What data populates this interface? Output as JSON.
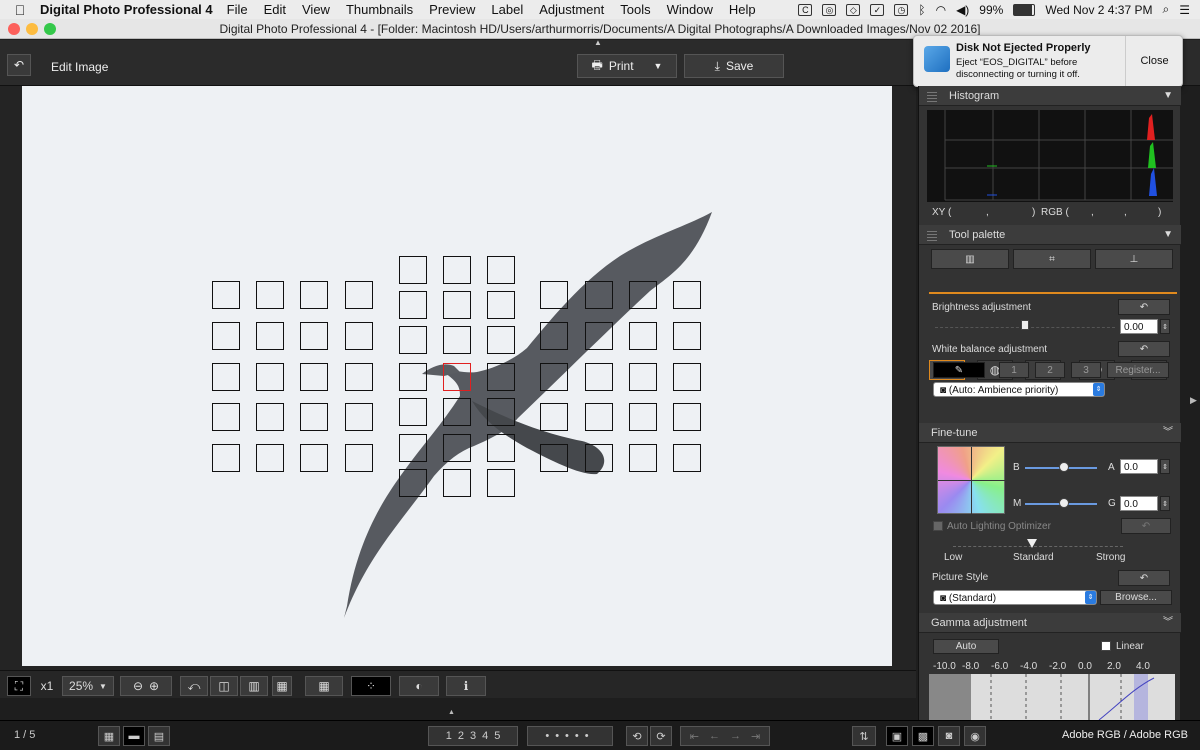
{
  "menubar": {
    "app_name": "Digital Photo Professional 4",
    "items": [
      "File",
      "Edit",
      "View",
      "Thumbnails",
      "Preview",
      "Label",
      "Adjustment",
      "Tools",
      "Window",
      "Help"
    ],
    "battery": "99%",
    "clock": "Wed Nov 2  4:37 PM"
  },
  "window": {
    "title": "Digital Photo Professional 4 - [Folder: Macintosh HD/Users/arthurmorris/Documents/A Digital Photographs/A Downloaded Images/Nov 02 2016]"
  },
  "toolbar": {
    "edit_label": "Edit Image",
    "print_label": "Print",
    "save_label": "Save"
  },
  "notification": {
    "title": "Disk Not Ejected Properly",
    "body_line1": "Eject “EOS_DIGITAL” before",
    "body_line2": "disconnecting or turning it off.",
    "close_label": "Close"
  },
  "histogram": {
    "title": "Histogram",
    "xy_label": "XY (",
    "xy_comma1": ",",
    "xy_close": ")",
    "rgb_label": "RGB (",
    "rgb_comma1": ",",
    "rgb_comma2": ",",
    "rgb_close": ")"
  },
  "tool_palette": {
    "title": "Tool palette",
    "brightness_label": "Brightness adjustment",
    "brightness_value": "0.00",
    "brightness_level": 0.5,
    "wb_label": "White balance adjustment",
    "wb_preset1": "1",
    "wb_preset2": "2",
    "wb_preset3": "3",
    "register_label": "Register...",
    "wb_mode": "(Auto: Ambience priority)"
  },
  "fine_tune": {
    "title": "Fine-tune",
    "b_label": "B",
    "a_label": "A",
    "a_value": "0.0",
    "m_label": "M",
    "g_label": "G",
    "g_value": "0.0",
    "alo_label": "Auto Lighting Optimizer",
    "low_label": "Low",
    "standard_label": "Standard",
    "strong_label": "Strong",
    "picture_style_label": "Picture Style",
    "picture_style_value": "(Standard)",
    "browse_label": "Browse..."
  },
  "gamma": {
    "title": "Gamma adjustment",
    "auto_label": "Auto",
    "linear_label": "Linear",
    "scale": [
      "-10.0",
      "-8.0",
      "-6.0",
      "-4.0",
      "-2.0",
      "0.0",
      "2.0",
      "4.0"
    ]
  },
  "bottombar": {
    "zoom_mult": "x1",
    "zoom_value": "25%"
  },
  "statusbar": {
    "page": "1 / 5",
    "rating_labels": [
      "1",
      "2",
      "3",
      "4",
      "5"
    ],
    "color_space": "Adobe RGB / Adobe RGB"
  },
  "colors": {
    "accent": "#e08a1e",
    "af_selected": "#e02020",
    "photo_bg": "#eef1f4"
  }
}
